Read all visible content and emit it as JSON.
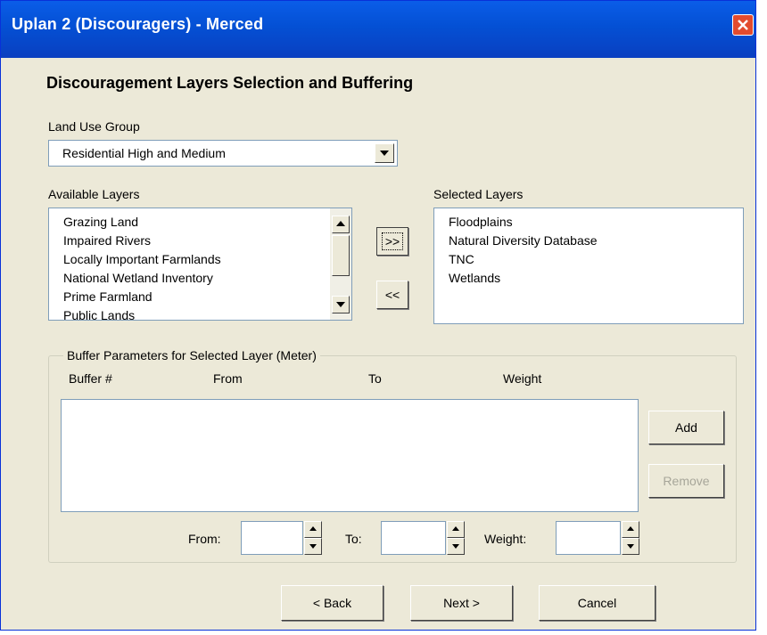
{
  "window": {
    "title": "Uplan 2 (Discouragers) - Merced"
  },
  "heading": "Discouragement Layers Selection and Buffering",
  "land_use_group": {
    "label": "Land Use Group",
    "value": "Residential High and Medium"
  },
  "available_layers": {
    "label": "Available Layers",
    "items": [
      "Grazing Land",
      "Impaired Rivers",
      "Locally Important Farmlands",
      "National Wetland Inventory",
      "Prime Farmland",
      "Public Lands"
    ]
  },
  "selected_layers": {
    "label": "Selected Layers",
    "items": [
      "Floodplains",
      "Natural Diversity Database",
      "TNC",
      "Wetlands"
    ]
  },
  "transfer": {
    "add_label": ">>",
    "remove_label": "<<"
  },
  "buffer": {
    "legend": "Buffer Parameters for Selected Layer (Meter)",
    "columns": [
      "Buffer #",
      "From",
      "To",
      "Weight"
    ],
    "add_label": "Add",
    "remove_label": "Remove",
    "from_label": "From:",
    "to_label": "To:",
    "weight_label": "Weight:",
    "from_value": "",
    "to_value": "",
    "weight_value": ""
  },
  "footer": {
    "back_label": "< Back",
    "next_label": "Next >",
    "cancel_label": "Cancel"
  },
  "colors": {
    "titlebar": "#0450d4",
    "background": "#ece9d8",
    "close": "#e24b2e"
  }
}
